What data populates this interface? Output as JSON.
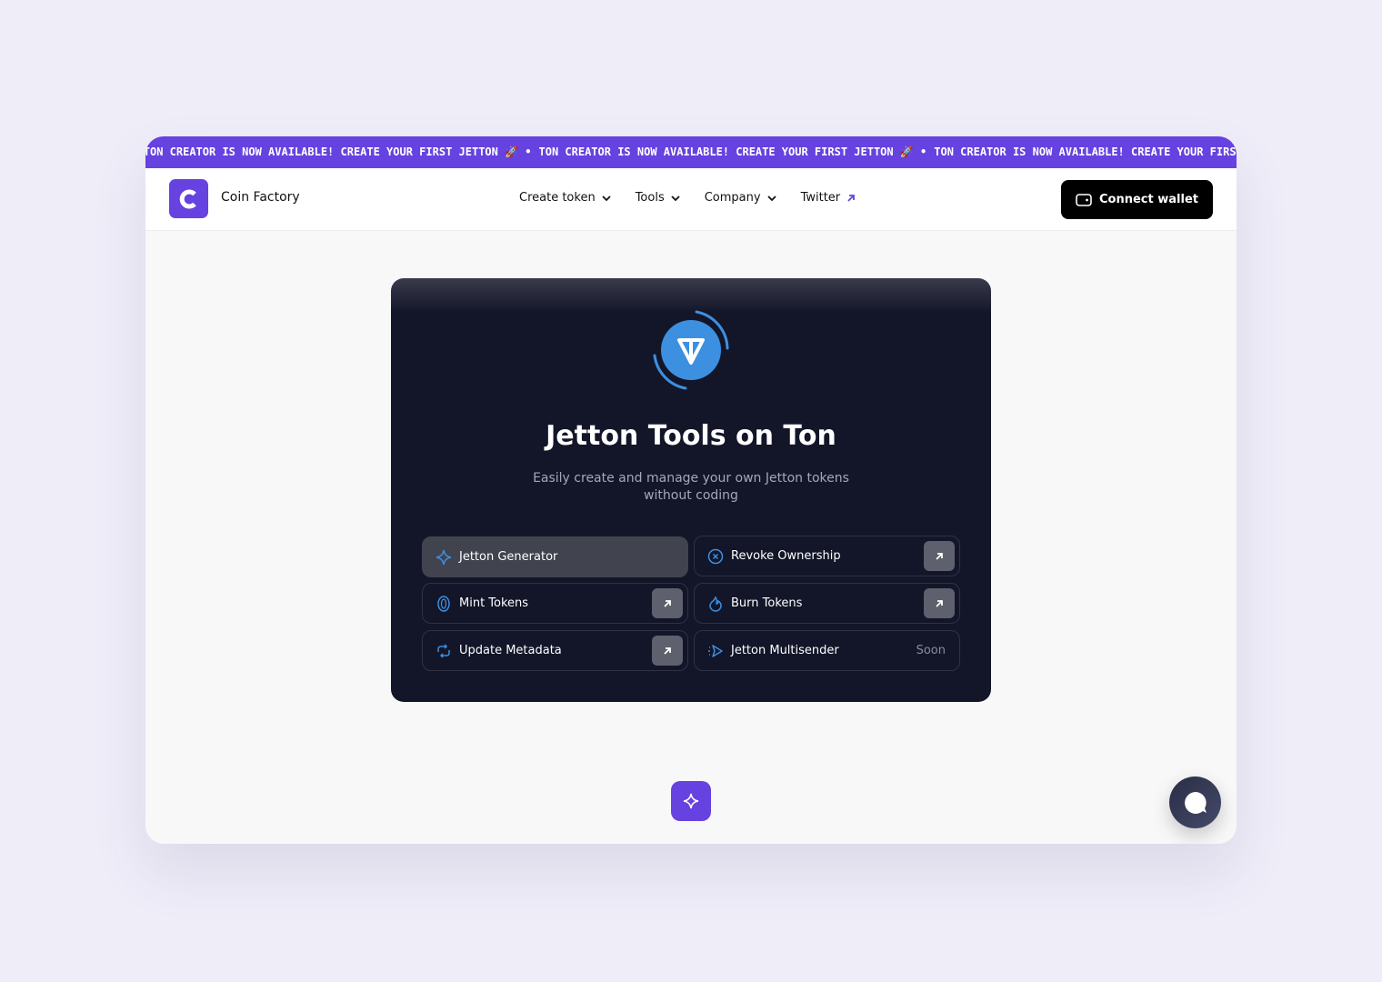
{
  "ticker": {
    "text": "TON CREATOR IS NOW AVAILABLE! CREATE YOUR FIRST JETTON 🚀 •"
  },
  "header": {
    "brand": "Coin Factory",
    "nav": [
      {
        "label": "Create token"
      },
      {
        "label": "Tools"
      },
      {
        "label": "Company"
      },
      {
        "label": "Twitter"
      }
    ],
    "connect_label": "Connect wallet"
  },
  "hero": {
    "title": "Jetton Tools on Ton",
    "subtitle": "Easily create and manage your own Jetton tokens without coding"
  },
  "tools": [
    {
      "label": "Jetton Generator",
      "icon": "sparkle-icon"
    },
    {
      "label": "Revoke Ownership",
      "icon": "x-circle-icon"
    },
    {
      "label": "Mint Tokens",
      "icon": "coin-icon"
    },
    {
      "label": "Burn Tokens",
      "icon": "flame-icon"
    },
    {
      "label": "Update Metadata",
      "icon": "refresh-icon"
    },
    {
      "label": "Jetton Multisender",
      "icon": "send-icon",
      "badge": "Soon"
    }
  ],
  "colors": {
    "accent": "#6642e0",
    "card": "#131629",
    "icon": "#3d8fe0"
  }
}
